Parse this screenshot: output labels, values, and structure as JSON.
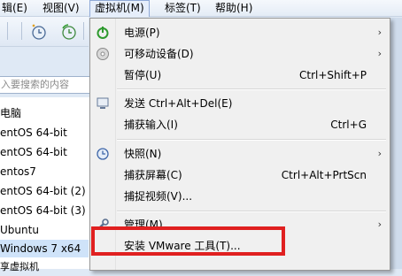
{
  "menubar": {
    "items": [
      {
        "label": "辑(E)"
      },
      {
        "label": "视图(V)"
      },
      {
        "label": "虚拟机(M)"
      },
      {
        "label": "标签(T)"
      },
      {
        "label": "帮助(H)"
      }
    ]
  },
  "search": {
    "placeholder": "入要搜索的内容"
  },
  "library": {
    "items": [
      {
        "label": "电脑"
      },
      {
        "label": "entOS 64-bit"
      },
      {
        "label": "entOS 64-bit"
      },
      {
        "label": "entos7"
      },
      {
        "label": "entOS 64-bit (2)"
      },
      {
        "label": "entOS 64-bit (3)"
      },
      {
        "label": "Ubuntu"
      },
      {
        "label": "Windows 7 x64"
      },
      {
        "label": "享虚拟机"
      }
    ]
  },
  "menu": {
    "items": [
      {
        "label": "电源(P)",
        "shortcut": "",
        "submenu": true,
        "icon": "power-icon"
      },
      {
        "label": "可移动设备(D)",
        "shortcut": "",
        "submenu": true,
        "icon": "disc-icon"
      },
      {
        "label": "暂停(U)",
        "shortcut": "Ctrl+Shift+P",
        "submenu": false,
        "icon": ""
      },
      {
        "label": "发送 Ctrl+Alt+Del(E)",
        "shortcut": "",
        "submenu": false,
        "icon": "send-keys-icon"
      },
      {
        "label": "捕获输入(I)",
        "shortcut": "Ctrl+G",
        "submenu": false,
        "icon": ""
      },
      {
        "label": "快照(N)",
        "shortcut": "",
        "submenu": true,
        "icon": "snapshot-icon"
      },
      {
        "label": "捕获屏幕(C)",
        "shortcut": "Ctrl+Alt+PrtScn",
        "submenu": false,
        "icon": ""
      },
      {
        "label": "捕捉视频(V)...",
        "shortcut": "",
        "submenu": false,
        "icon": ""
      },
      {
        "label": "管理(M)",
        "shortcut": "",
        "submenu": true,
        "icon": "wrench-icon"
      },
      {
        "label": "安装 VMware 工具(T)...",
        "shortcut": "",
        "submenu": false,
        "icon": ""
      }
    ],
    "arrow": "›"
  },
  "colors": {
    "highlight_box": "#e02020",
    "selection": "#cfe3f9"
  }
}
